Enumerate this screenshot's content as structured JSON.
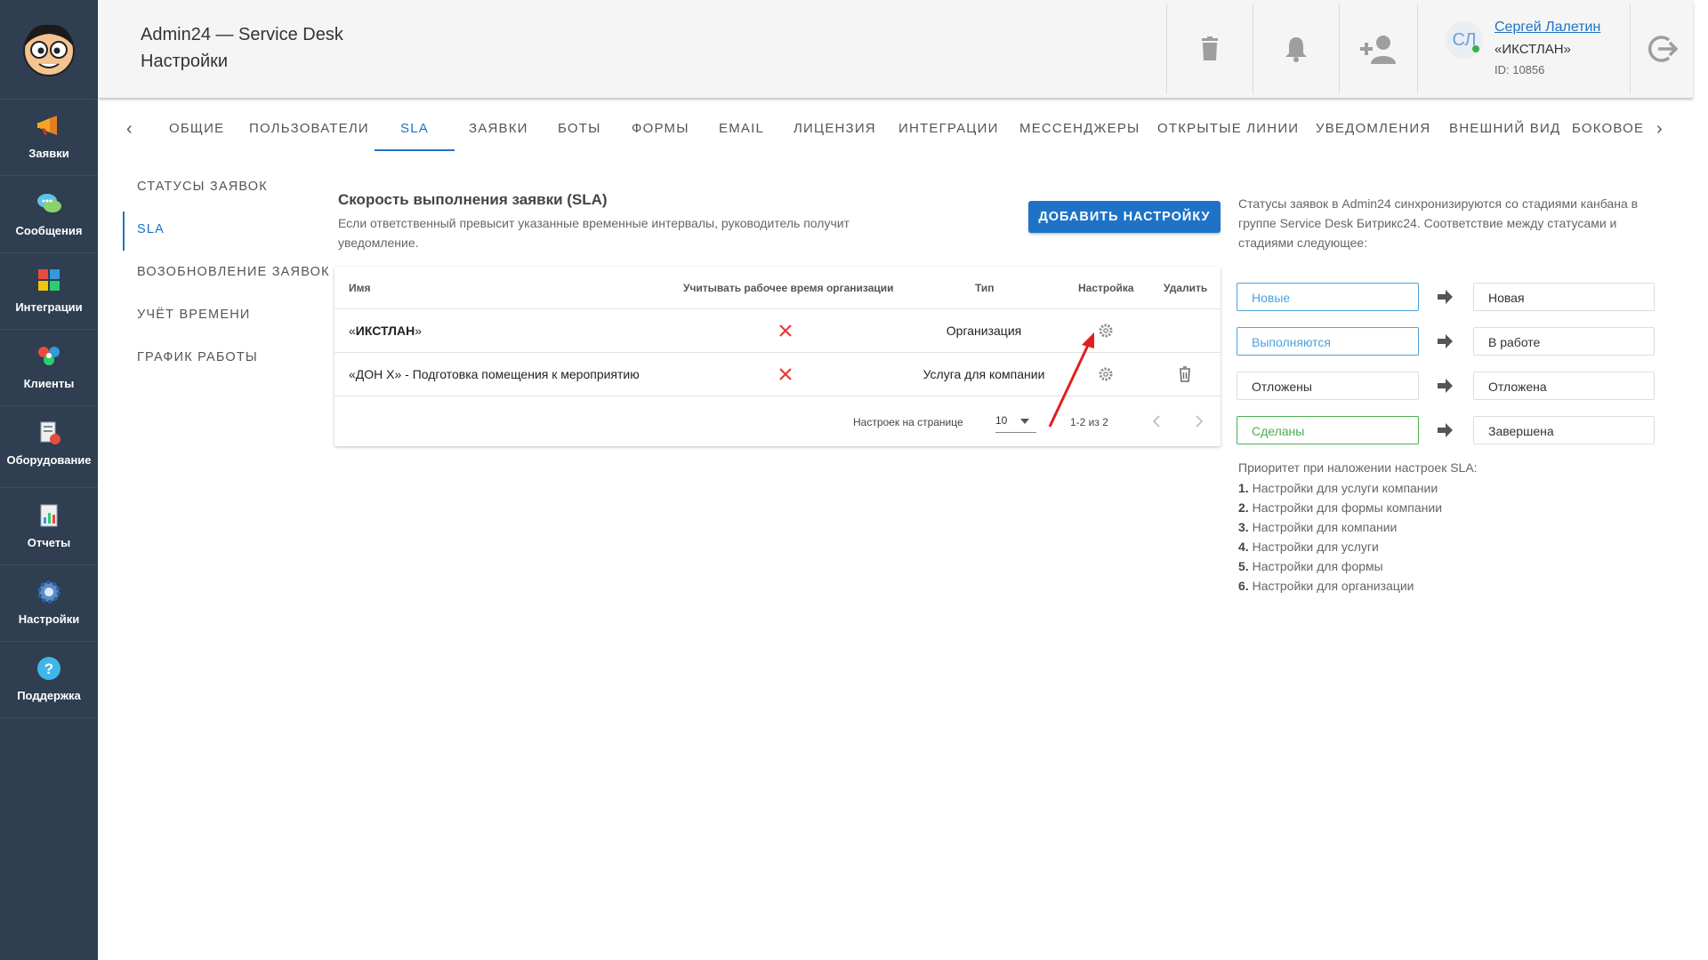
{
  "header": {
    "app_title": "Admin24 — Service Desk",
    "page_title": "Настройки",
    "user": {
      "initials": "СЛ",
      "name": "Сергей Лалетин",
      "org": "«ИКСТЛАН»",
      "id": "ID: 10856"
    }
  },
  "sidebar": {
    "items": [
      {
        "label": "Заявки",
        "icon": "megaphone-icon"
      },
      {
        "label": "Сообщения",
        "icon": "chat-bubbles-icon"
      },
      {
        "label": "Интеграции",
        "icon": "puzzle-icon"
      },
      {
        "label": "Клиенты",
        "icon": "people-icon"
      },
      {
        "label": "Оборудование",
        "icon": "equipment-icon"
      },
      {
        "label": "Отчеты",
        "icon": "report-icon"
      },
      {
        "label": "Настройки",
        "icon": "gear-icon"
      },
      {
        "label": "Поддержка",
        "icon": "help-icon"
      }
    ]
  },
  "tabs": [
    "ОБЩИЕ",
    "ПОЛЬЗОВАТЕЛИ",
    "SLA",
    "ЗАЯВКИ",
    "БОТЫ",
    "ФОРМЫ",
    "EMAIL",
    "ЛИЦЕНЗИЯ",
    "ИНТЕГРАЦИИ",
    "МЕССЕНДЖЕРЫ",
    "ОТКРЫТЫЕ ЛИНИИ",
    "УВЕДОМЛЕНИЯ",
    "ВНЕШНИЙ ВИД",
    "БОКОВОЕ"
  ],
  "subnav": [
    "СТАТУСЫ ЗАЯВОК",
    "SLA",
    "ВОЗОБНОВЛЕНИЕ ЗАЯВОК",
    "УЧЁТ ВРЕМЕНИ",
    "ГРАФИК РАБОТЫ"
  ],
  "section": {
    "title": "Скорость выполнения заявки (SLA)",
    "description": "Если ответственный превысит указанные временные интервалы, руководитель получит уведомление.",
    "add_button": "ДОБАВИТЬ НАСТРОЙКУ"
  },
  "table": {
    "columns": [
      "Имя",
      "Учитывать рабочее время организации",
      "Тип",
      "Настройка",
      "Удалить"
    ],
    "rows": [
      {
        "name_prefix": "«",
        "name_bold": "ИКСТЛАН",
        "name_suffix": "»",
        "type": "Организация"
      },
      {
        "name": "«ДОН Х» - Подготовка помещения к мероприятию",
        "type": "Услуга для компании"
      }
    ],
    "pagination": {
      "per_page_label": "Настроек на странице",
      "per_page": "10",
      "range": "1-2 из 2"
    }
  },
  "info": {
    "text": "Статусы заявок в Admin24 синхронизируются со стадиями канбана в группе Service Desk Битрикс24. Соответствие между статусами и стадиями следующее:",
    "mappings": [
      {
        "status": "Новые",
        "stage": "Новая",
        "color": "#4aa3df"
      },
      {
        "status": "Выполняются",
        "stage": "В работе",
        "color": "#4aa3df"
      },
      {
        "status": "Отложены",
        "stage": "Отложена",
        "color": "#333333"
      },
      {
        "status": "Сделаны",
        "stage": "Завершена",
        "color": "#4caf50"
      }
    ],
    "priority_title": "Приоритет при наложении настроек SLA:",
    "priority": [
      {
        "n": "1.",
        "text": "Настройки для услуги компании"
      },
      {
        "n": "2.",
        "text": "Настройки для формы компании"
      },
      {
        "n": "3.",
        "text": "Настройки для компании"
      },
      {
        "n": "4.",
        "text": "Настройки для услуги"
      },
      {
        "n": "5.",
        "text": "Настройки для формы"
      },
      {
        "n": "6.",
        "text": "Настройки для организации"
      }
    ]
  }
}
